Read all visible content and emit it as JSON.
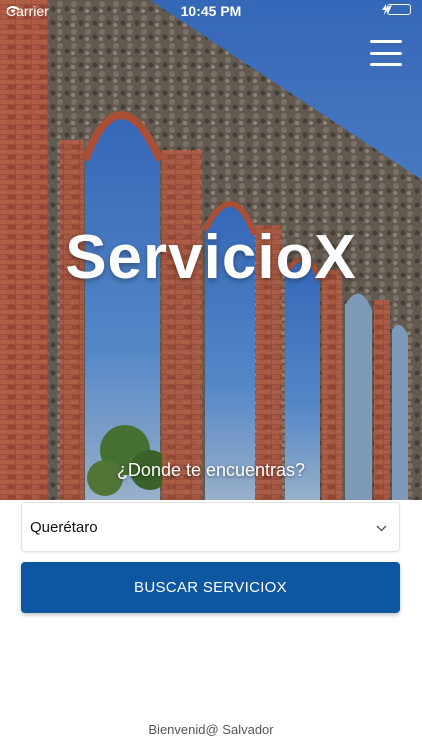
{
  "status_bar": {
    "carrier": "Carrier",
    "time": "10:45 PM",
    "wifi_icon": "wifi-icon",
    "location_icon": "location-arrow-icon",
    "battery_icon": "battery-icon",
    "charging_icon": "charging-bolt-icon"
  },
  "header": {
    "menu_icon": "hamburger-menu-icon",
    "title": "ServicioX"
  },
  "hero": {
    "question": "¿Donde te encuentras?"
  },
  "location_select": {
    "selected": "Querétaro",
    "chevron_icon": "chevron-down-icon"
  },
  "search_button": {
    "label": "BUSCAR SERVICIOX"
  },
  "footer": {
    "welcome": "Bienvenid@ Salvador"
  },
  "colors": {
    "primary": "#0d57a2",
    "battery": "#4cd964",
    "text_light": "#ffffff"
  }
}
